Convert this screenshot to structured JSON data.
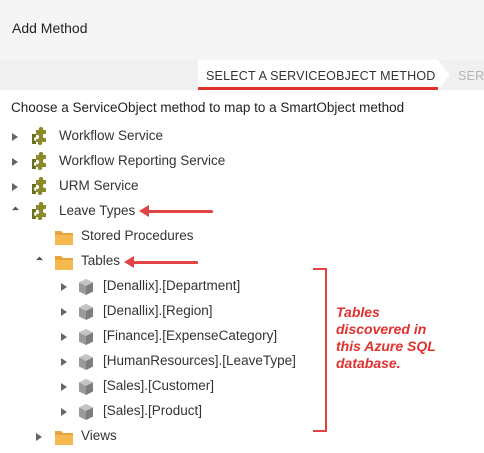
{
  "dialog": {
    "title": "Add Method"
  },
  "wizard": {
    "active_step": "SELECT A SERVICEOBJECT METHOD",
    "next_step": "SERV"
  },
  "instruction": "Choose a ServiceObject method to map to a SmartObject method",
  "tree": {
    "workflow_service": "Workflow Service",
    "workflow_reporting_service": "Workflow Reporting Service",
    "urm_service": "URM Service",
    "leave_types": "Leave Types",
    "stored_procedures": "Stored Procedures",
    "tables": "Tables",
    "tables_children": [
      "[Denallix].[Department]",
      "[Denallix].[Region]",
      "[Finance].[ExpenseCategory]",
      "[HumanResources].[LeaveType]",
      "[Sales].[Customer]",
      "[Sales].[Product]"
    ],
    "views": "Views"
  },
  "annotation": {
    "lines": [
      "Tables",
      "discovered in",
      "this Azure SQL",
      "database."
    ],
    "color": "#e0312f"
  },
  "icons": {
    "service": "puzzle-piece-icon",
    "folder": "folder-icon",
    "table": "cube-icon"
  }
}
